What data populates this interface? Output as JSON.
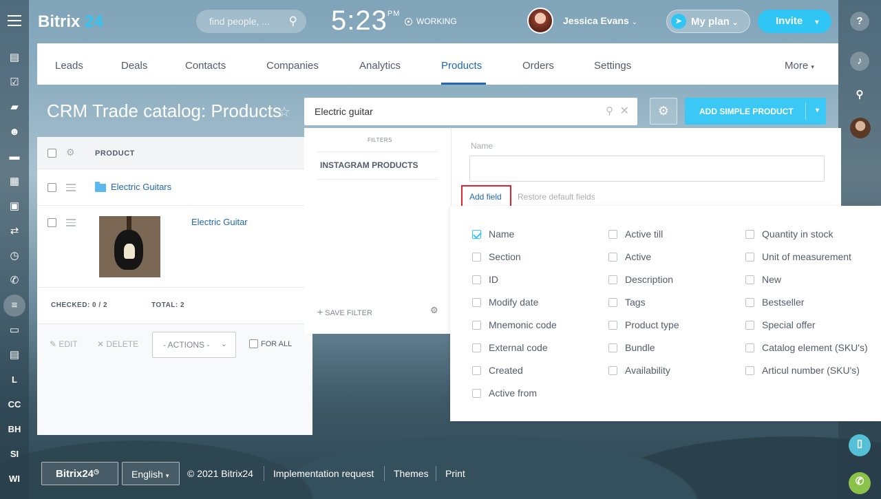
{
  "app": {
    "logo_text": "Bitrix",
    "logo_num": "24"
  },
  "header": {
    "search_placeholder": "find people, ...",
    "time": "5:23",
    "time_suffix": "PM",
    "status": "WORKING",
    "user_name": "Jessica Evans",
    "my_plan_label": "My plan",
    "invite_label": "Invite"
  },
  "nav": {
    "items": [
      "Leads",
      "Deals",
      "Contacts",
      "Companies",
      "Analytics",
      "Products",
      "Orders",
      "Settings"
    ],
    "more_label": "More",
    "active": "Products"
  },
  "left_sidebar": {
    "text_items": [
      "L",
      "CC",
      "BH",
      "SI",
      "WI"
    ]
  },
  "page": {
    "title": "CRM Trade catalog: Products",
    "search_value": "Electric guitar",
    "add_button_label": "ADD SIMPLE PRODUCT"
  },
  "table": {
    "header_product": "PRODUCT",
    "rows": [
      {
        "label": "Electric Guitars",
        "type": "folder"
      },
      {
        "label": "Electric Guitar",
        "type": "product"
      }
    ],
    "checked_label": "CHECKED: 0 / 2",
    "total_label": "TOTAL: 2",
    "edit_label": "EDIT",
    "delete_label": "DELETE",
    "actions_label": "- ACTIONS -",
    "for_all_label": "FOR ALL"
  },
  "filter": {
    "filters_heading": "FILTERS",
    "preset": "INSTAGRAM PRODUCTS",
    "save_filter_label": "SAVE FILTER",
    "name_label": "Name",
    "name_value": "",
    "add_field_label": "Add field",
    "restore_label": "Restore default fields"
  },
  "fields": {
    "col1": [
      {
        "label": "Name",
        "checked": true
      },
      {
        "label": "Section",
        "checked": false
      },
      {
        "label": "ID",
        "checked": false
      },
      {
        "label": "Modify date",
        "checked": false
      },
      {
        "label": "Mnemonic code",
        "checked": false
      },
      {
        "label": "External code",
        "checked": false
      },
      {
        "label": "Created",
        "checked": false
      },
      {
        "label": "Active from",
        "checked": false
      }
    ],
    "col2": [
      {
        "label": "Active till",
        "checked": false
      },
      {
        "label": "Active",
        "checked": false
      },
      {
        "label": "Description",
        "checked": false
      },
      {
        "label": "Tags",
        "checked": false
      },
      {
        "label": "Product type",
        "checked": false
      },
      {
        "label": "Bundle",
        "checked": false
      },
      {
        "label": "Availability",
        "checked": false
      }
    ],
    "col3": [
      {
        "label": "Quantity in stock",
        "checked": false
      },
      {
        "label": "Unit of measurement",
        "checked": false
      },
      {
        "label": "New",
        "checked": false
      },
      {
        "label": "Bestseller",
        "checked": false
      },
      {
        "label": "Special offer",
        "checked": false
      },
      {
        "label": "Catalog element (SKU's)",
        "checked": false
      },
      {
        "label": "Articul number (SKU's)",
        "checked": false
      }
    ]
  },
  "footer": {
    "b24_label": "Bitrix24",
    "language": "English",
    "copyright": "© 2021 Bitrix24",
    "implementation": "Implementation request",
    "themes": "Themes",
    "print": "Print"
  },
  "colors": {
    "accent": "#2fc6f6",
    "link": "#2067b0",
    "highlight": "#e1222f"
  }
}
